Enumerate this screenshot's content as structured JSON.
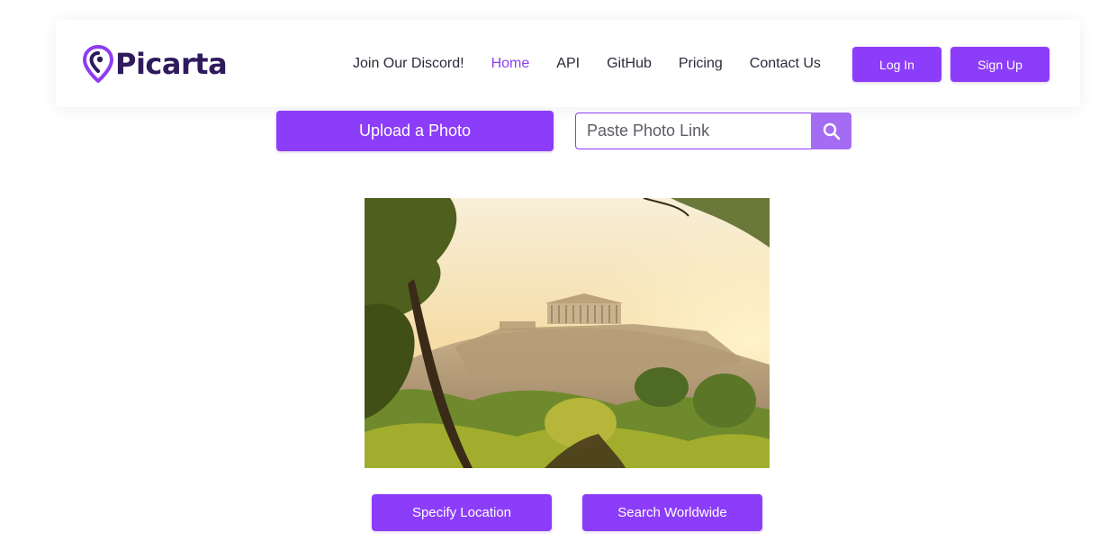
{
  "brand": {
    "name": "Picarta",
    "logo_color": "#2f1a5e",
    "pin_color": "#8c3df0"
  },
  "nav": {
    "links": [
      {
        "label": "Join Our Discord!",
        "active": false
      },
      {
        "label": "Home",
        "active": true
      },
      {
        "label": "API",
        "active": false
      },
      {
        "label": "GitHub",
        "active": false
      },
      {
        "label": "Pricing",
        "active": false
      },
      {
        "label": "Contact Us",
        "active": false
      }
    ],
    "login_label": "Log In",
    "signup_label": "Sign Up"
  },
  "upload": {
    "button_label": "Upload a Photo",
    "link_placeholder": "Paste Photo Link",
    "search_icon": "search-icon"
  },
  "photo": {
    "alt": "Acropolis of Athens at sunset framed by trees",
    "icon": "photo-image"
  },
  "actions": {
    "specify_label": "Specify Location",
    "worldwide_label": "Search Worldwide"
  },
  "colors": {
    "accent": "#8c3df9",
    "accent_light": "#a46cf2",
    "active_link": "#8c3df0",
    "text": "#2b2a3a"
  }
}
